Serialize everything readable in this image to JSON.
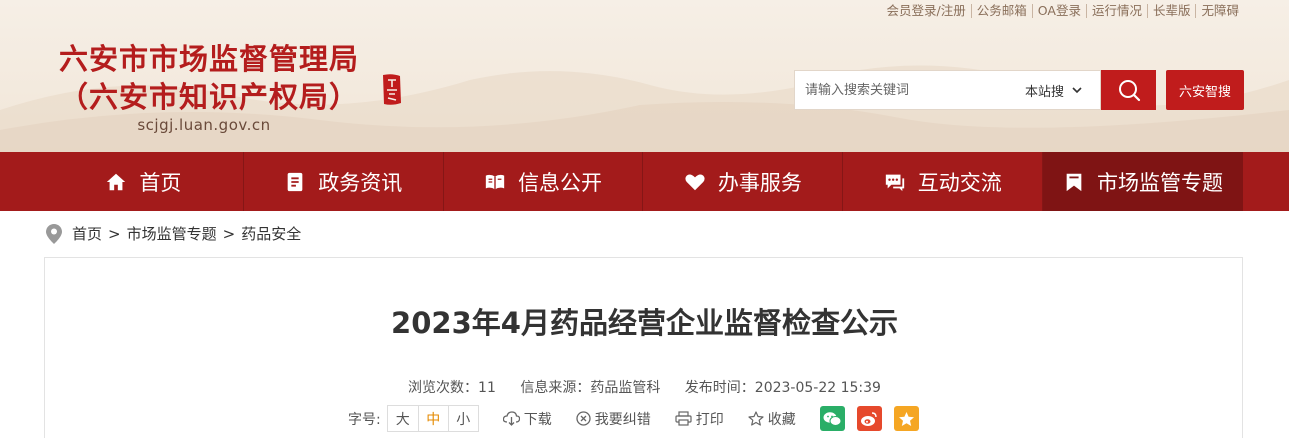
{
  "header": {
    "top_links": [
      "会员登录/注册",
      "公务邮箱",
      "OA登录",
      "运行情况",
      "长辈版",
      "无障碍"
    ],
    "site_title_line1": "六安市市场监督管理局",
    "site_title_line2": "（六安市知识产权局）",
    "domain": "scjgj.luan.gov.cn",
    "search_placeholder": "请输入搜索关键词",
    "search_scope": "本站搜",
    "zhihui_label": "六安智搜"
  },
  "nav": {
    "items": [
      {
        "label": "首页",
        "icon": "home-icon"
      },
      {
        "label": "政务资讯",
        "icon": "document-icon"
      },
      {
        "label": "信息公开",
        "icon": "open-book-icon"
      },
      {
        "label": "办事服务",
        "icon": "heart-icon"
      },
      {
        "label": "互动交流",
        "icon": "chat-icon"
      },
      {
        "label": "市场监管专题",
        "icon": "bookmark-icon"
      }
    ],
    "active_index": 5
  },
  "breadcrumb": [
    "首页",
    "市场监管专题",
    "药品安全"
  ],
  "article": {
    "title": "2023年4月药品经营企业监督检查公示",
    "views": "浏览次数：11",
    "source": "信息来源：药品监管科",
    "published": "发布时间：2023-05-22 15:39",
    "font_label": "字号:",
    "font_sizes": [
      "大",
      "中",
      "小"
    ],
    "download": "下载",
    "report_error": "我要纠错",
    "print": "打印",
    "favorite": "收藏"
  },
  "colors": {
    "brand_red": "#c01c1c",
    "nav_red": "#a31b1b",
    "nav_active": "#7f1414",
    "wechat": "#2aae67",
    "weibo": "#e6492c",
    "qzone": "#f5a623"
  }
}
